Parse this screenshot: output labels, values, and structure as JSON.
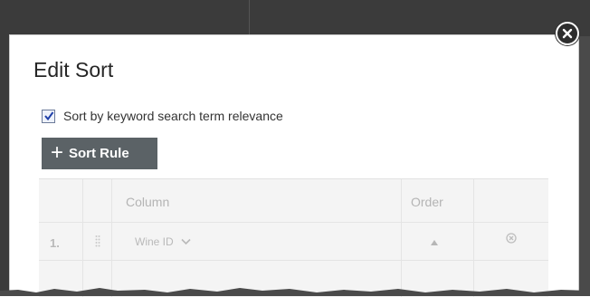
{
  "dialog": {
    "title": "Edit Sort",
    "close_icon": "close-circle-icon",
    "relevance_checkbox": {
      "checked": true,
      "label": "Sort by keyword search term relevance"
    },
    "add_rule_button": {
      "icon": "plus-icon",
      "label": "Sort Rule"
    }
  },
  "table": {
    "columns": [
      "Column",
      "Order"
    ],
    "rows": [
      {
        "number": "1.",
        "column_value": "Wine ID",
        "order_icon": "triangle-up-icon",
        "remove_icon": "remove-circle-icon"
      }
    ]
  }
}
